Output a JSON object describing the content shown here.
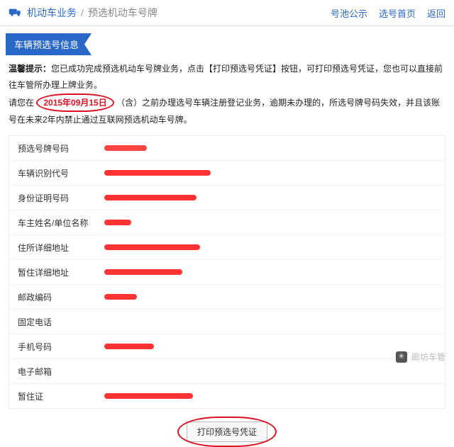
{
  "header": {
    "bc1": "机动车业务",
    "bc2": "预选机动车号牌",
    "links": [
      "号池公示",
      "选号首页",
      "返回"
    ]
  },
  "ribbon": "车辆预选号信息",
  "notice": {
    "prefix": "温馨提示：",
    "line1": "您已成功完成预选机动车号牌业务，点击【打印预选号凭证】按钮，可打印预选号凭证，您也可以直接前往车管所办理上牌业务。",
    "line2a": "请您在 ",
    "date": "2015年09月15日",
    "line2b": "（含）之前办理选号车辆注册登记业务，逾期未办理的，所选号牌号码失效，并且该账号在未来2年内禁止通过互联网预选机动车号牌。"
  },
  "fields": [
    {
      "label": "预选号牌号码"
    },
    {
      "label": "车辆识别代号"
    },
    {
      "label": "身份证明号码"
    },
    {
      "label": "车主姓名/单位名称"
    },
    {
      "label": "住所详细地址"
    },
    {
      "label": "暂住详细地址"
    },
    {
      "label": "邮政编码"
    },
    {
      "label": "固定电话"
    },
    {
      "label": "手机号码"
    },
    {
      "label": "电子邮箱"
    },
    {
      "label": "暂住证"
    }
  ],
  "button": "打印预选号凭证",
  "wechat": "廊坊车管"
}
